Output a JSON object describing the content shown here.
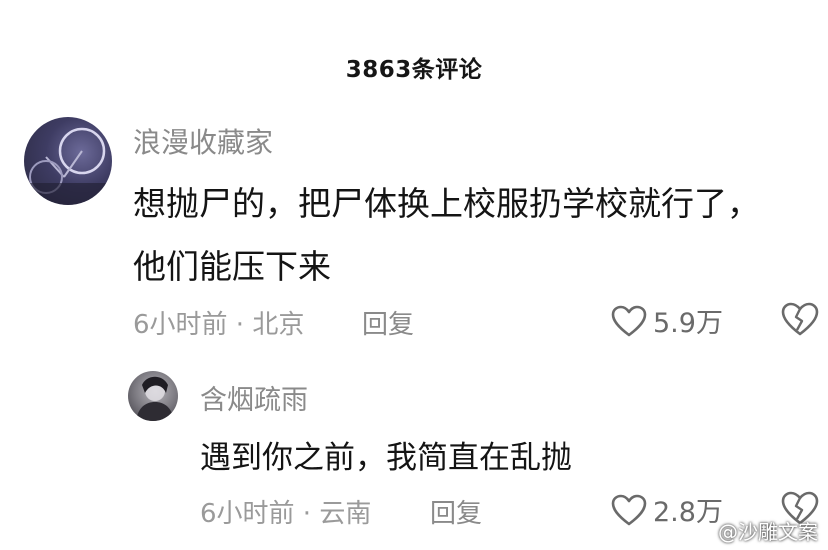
{
  "header": {
    "title": "3863条评论"
  },
  "comments": [
    {
      "username": "浪漫收藏家",
      "text_lines": [
        "想抛尸的，把尸体换上校服扔学校就行了，",
        "他们能压下来"
      ],
      "meta": "6小时前 · 北京",
      "reply_label": "回复",
      "likes": "5.9万",
      "avatar_icon": "bicycle-photo-avatar"
    },
    {
      "username": "含烟疏雨",
      "text_lines": [
        "遇到你之前，我简直在乱抛"
      ],
      "meta": "6小时前 · 云南",
      "reply_label": "回复",
      "likes": "2.8万",
      "avatar_icon": "person-photo-avatar"
    }
  ],
  "icons": {
    "like": "heart-outline-icon",
    "dislike": "broken-heart-icon"
  },
  "colors": {
    "text": "#141414",
    "secondary": "#8a8a8a",
    "icon": "#6a6a6a"
  },
  "watermark": {
    "text": "@沙雕文案"
  }
}
